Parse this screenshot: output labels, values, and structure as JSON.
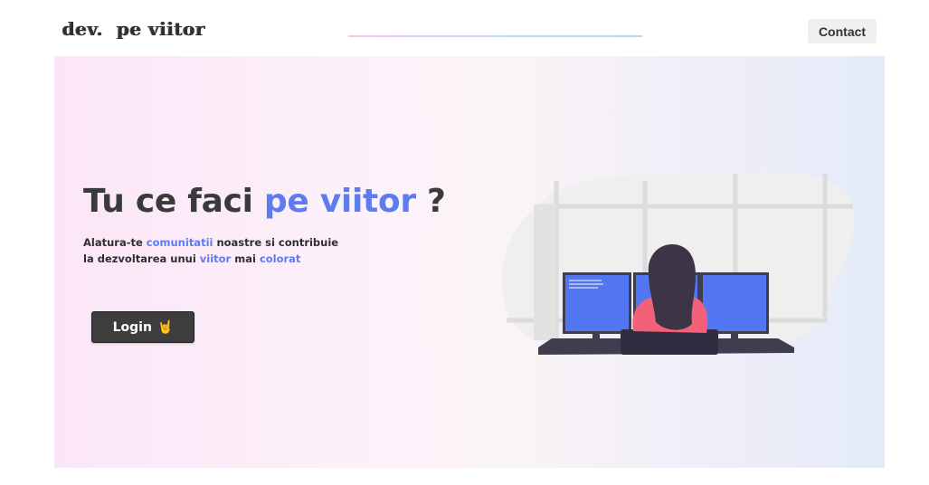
{
  "header": {
    "logo_text": "dev.  pe viitor",
    "contact_label": "Contact"
  },
  "hero": {
    "headline_part1": "Tu ce faci ",
    "headline_accent": "pe viitor",
    "headline_part2": " ?",
    "subtext": {
      "line1_a": "Alatura-te ",
      "line1_accent": "comunitatii",
      "line1_b": " noastre si contribuie",
      "line2_a": "la dezvoltarea unui ",
      "line2_accent1": "viitor",
      "line2_b": " mai ",
      "line2_accent2": "colorat"
    },
    "login_label": "Login",
    "login_emoji": "🤘"
  },
  "illustration": {
    "icon": "woman-at-computers-illustration",
    "colors": {
      "screen": "#5275f2",
      "hair": "#3d3446",
      "shirt": "#f2607a",
      "desk": "#3f3d4e",
      "blob": "#efefef",
      "window_frame": "#dcdcdc"
    }
  },
  "colors": {
    "accent": "#5c7cf0",
    "text_dark": "#3a3a3a",
    "button_dark": "#3d3d3d",
    "contact_bg": "#efefef"
  }
}
